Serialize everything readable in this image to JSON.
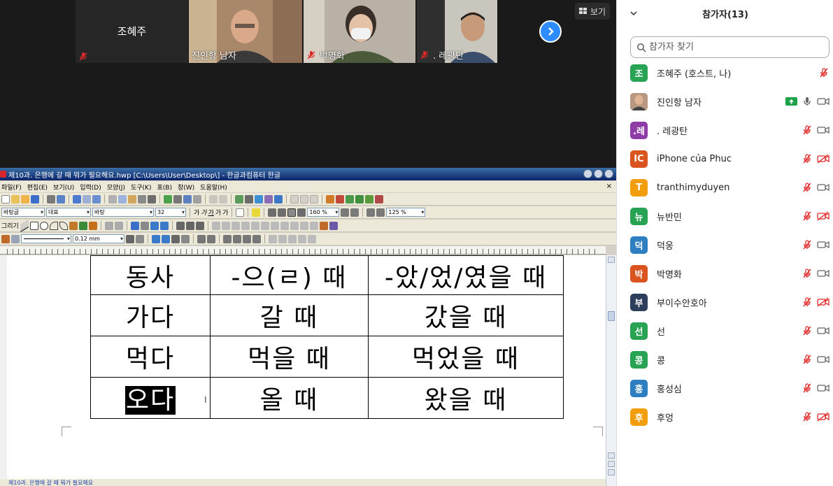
{
  "gallery": {
    "tiles": [
      {
        "name": "조혜주",
        "muted": true
      },
      {
        "name": "진인항 남자",
        "muted": false
      },
      {
        "name": "박명화",
        "muted": true
      },
      {
        "name": ". 레광탄",
        "muted": true
      }
    ],
    "view_label": "보기"
  },
  "hwp": {
    "title": "제10과. 은행에 갈 때 뭐가 필요해요.hwp [C:\\Users\\User\\Desktop\\] - 한글과컴퓨터 한글",
    "menu": [
      "파일(F)",
      "편집(E)",
      "보기(U)",
      "입력(D)",
      "모양(J)",
      "도구(K)",
      "표(B)",
      "창(W)",
      "도움말(H)"
    ],
    "toolbar": {
      "style": "바탕글",
      "lang": "대표",
      "font": "바탕",
      "size": "32",
      "line_spacing": "160 %",
      "zoom": "125 %",
      "draw_label": "그리기",
      "line_width": "0.12 mm"
    },
    "table": {
      "rows": [
        [
          "동사",
          "-으(ㄹ) 때",
          "-았/었/였을 때"
        ],
        [
          "가다",
          "갈 때",
          "갔을 때"
        ],
        [
          "먹다",
          "먹을 때",
          "먹었을 때"
        ],
        [
          "오다",
          "올 때",
          "왔을 때"
        ]
      ]
    },
    "status": "제10과. 은행에 갈 때 뭐가 필요해요"
  },
  "panel": {
    "title": "참가자(13)",
    "search_placeholder": "참가자 찾기",
    "participants": [
      {
        "initial": "조",
        "name": "조혜주 (호스트, 나)",
        "color": "#27a353",
        "mic": "muted",
        "video": "none"
      },
      {
        "initial": "",
        "name": "진인항 남자",
        "color": "#8a6a50",
        "mic": "on",
        "video": "on",
        "share": true
      },
      {
        "initial": ".레",
        "name": ". 레광탄",
        "color": "#8e3ba6",
        "mic": "muted",
        "video": "on"
      },
      {
        "initial": "IC",
        "name": "iPhone của Phuc",
        "color": "#d9541e",
        "mic": "muted",
        "video": "off"
      },
      {
        "initial": "T",
        "name": "tranthimyduyen",
        "color": "#f29d0b",
        "mic": "muted",
        "video": "on"
      },
      {
        "initial": "뉴",
        "name": "뉴반민",
        "color": "#27a353",
        "mic": "muted",
        "video": "off"
      },
      {
        "initial": "덕",
        "name": "덕웅",
        "color": "#2d7fc1",
        "mic": "muted",
        "video": "on"
      },
      {
        "initial": "박",
        "name": "박명화",
        "color": "#d9541e",
        "mic": "muted",
        "video": "on"
      },
      {
        "initial": "부",
        "name": "부이수안호아",
        "color": "#2c3e5c",
        "mic": "muted",
        "video": "off"
      },
      {
        "initial": "선",
        "name": "선",
        "color": "#27a353",
        "mic": "muted",
        "video": "on"
      },
      {
        "initial": "콩",
        "name": "콩",
        "color": "#27a353",
        "mic": "muted",
        "video": "on"
      },
      {
        "initial": "홍",
        "name": "홍성심",
        "color": "#2d7fc1",
        "mic": "muted",
        "video": "on"
      },
      {
        "initial": "후",
        "name": "후엉",
        "color": "#f29d0b",
        "mic": "muted",
        "video": "off"
      }
    ]
  }
}
